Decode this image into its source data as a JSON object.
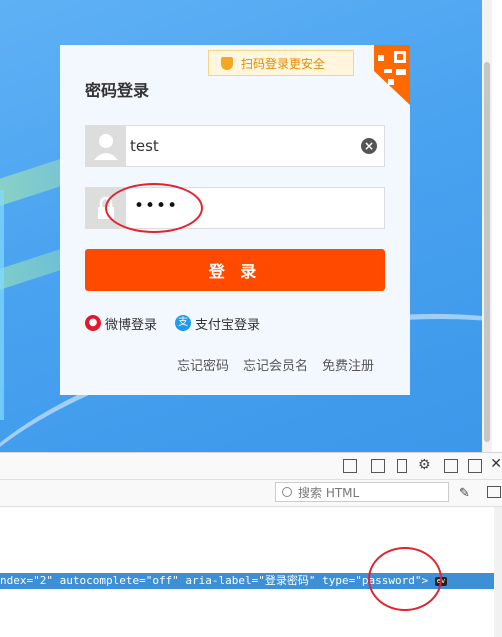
{
  "login": {
    "qr_tip": "扫码登录更安全",
    "title": "密码登录",
    "username_value": "test",
    "password_mask": "••••",
    "login_button": "登 录",
    "weibo_label": "微博登录",
    "alipay_label": "支付宝登录",
    "forgot_password": "忘记密码",
    "forgot_member_name": "忘记会员名",
    "register": "免费注册"
  },
  "devtools": {
    "search_placeholder": "搜索 HTML",
    "code_line": "ndex=\"2\" autocomplete=\"off\" aria-label=\"登录密码\" type=\"password\">",
    "event_badge": "ev"
  },
  "colors": {
    "accent": "#ff4a00",
    "annotation": "#e0252e",
    "selected_line": "#3d8fd6",
    "weibo": "#e6162d",
    "alipay": "#1e9bf0"
  }
}
